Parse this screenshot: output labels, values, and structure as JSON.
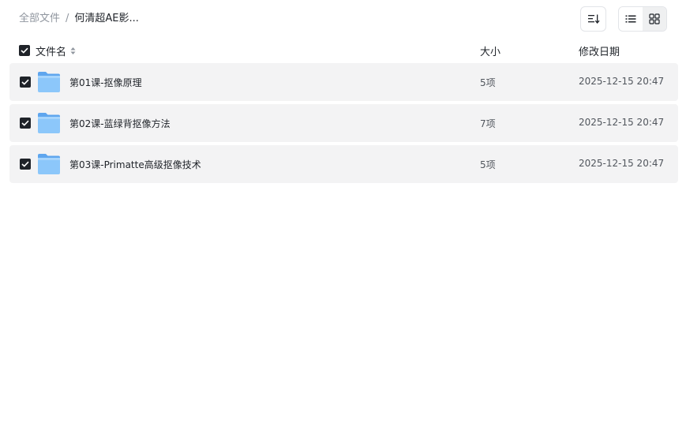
{
  "breadcrumb": {
    "root": "全部文件",
    "separator": "/",
    "current": "何清超AE影..."
  },
  "toolbar": {
    "sort_icon": "sort-icon",
    "list_view_icon": "list-view-icon",
    "grid_view_icon": "grid-view-icon",
    "active_view": "list"
  },
  "list_header": {
    "name": "文件名",
    "size": "大小",
    "date": "修改日期",
    "select_all_checked": true
  },
  "files": [
    {
      "name": "第01课-抠像原理",
      "size": "5项",
      "date": "2025-12-15 20:47",
      "checked": true
    },
    {
      "name": "第02课-蓝绿背抠像方法",
      "size": "7项",
      "date": "2025-12-15 20:47",
      "checked": true
    },
    {
      "name": "第03课-Primatte高级抠像技术",
      "size": "5项",
      "date": "2025-12-15 20:47",
      "checked": true
    }
  ],
  "colors": {
    "row_bg": "#f3f3f4",
    "checkbox": "#1f2329",
    "folder": "#7ab8f5"
  }
}
